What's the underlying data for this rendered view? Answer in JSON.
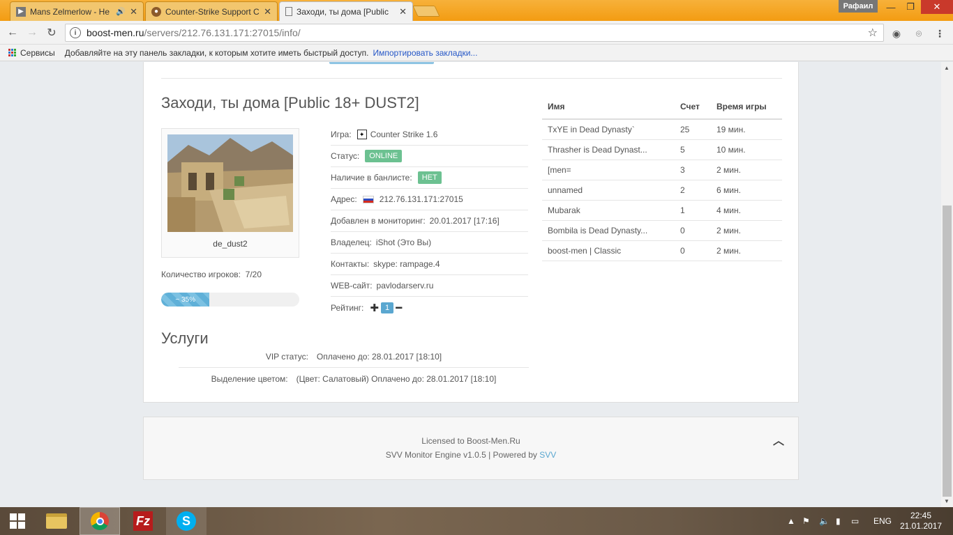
{
  "browser": {
    "tabs": [
      {
        "title": "Mans Zelmerlow - He",
        "icon": "youtube-icon"
      },
      {
        "title": "Counter-Strike Support C",
        "icon": "cs-icon"
      },
      {
        "title": "Заходи, ты дома [Public",
        "icon": "page-icon"
      }
    ],
    "user": "Рафаил",
    "url_host": "boost-men.ru",
    "url_path": "/servers/212.76.131.171:27015/info/",
    "bookmarks": {
      "apps_label": "Сервисы",
      "hint": "Добавляйте на эту панель закладки, к которым хотите иметь быстрый доступ.",
      "import_link": "Импортировать закладки..."
    }
  },
  "server": {
    "title": "Заходи, ты дома [Public 18+ DUST2]",
    "map": "de_dust2",
    "players_label": "Количество игроков:",
    "players_value": "7/20",
    "load_percent": 35,
    "load_label": "~ 35%",
    "info": {
      "game_label": "Игра:",
      "game_value": "Counter Strike 1.6",
      "status_label": "Статус:",
      "status_value": "ONLINE",
      "ban_label": "Наличие в банлисте:",
      "ban_value": "НЕТ",
      "addr_label": "Адрес:",
      "addr_value": "212.76.131.171:27015",
      "added_label": "Добавлен в мониторинг:",
      "added_value": "20.01.2017 [17:16]",
      "owner_label": "Владелец:",
      "owner_value": "iShot (Это Вы)",
      "contacts_label": "Контакты:",
      "contacts_value": "skype: rampage.4",
      "web_label": "WEB-сайт:",
      "web_value": "pavlodarserv.ru",
      "rating_label": "Рейтинг:",
      "rating_value": "1"
    },
    "services_title": "Услуги",
    "services": [
      {
        "name": "VIP статус:",
        "value": "Оплачено до: 28.01.2017 [18:10]"
      },
      {
        "name": "Выделение цветом:",
        "value": "(Цвет: Салатовый) Оплачено до: 28.01.2017 [18:10]"
      }
    ],
    "table": {
      "headers": [
        "Имя",
        "Счет",
        "Время игры"
      ],
      "rows": [
        [
          "TxYE in Dead Dynasty`",
          "25",
          "19 мин."
        ],
        [
          "Thrasher is Dead Dynast...",
          "5",
          "10 мин."
        ],
        [
          "[men=",
          "3",
          "2 мин."
        ],
        [
          "unnamed",
          "2",
          "6 мин."
        ],
        [
          "Mubarak",
          "1",
          "4 мин."
        ],
        [
          "Bombila is Dead Dynasty...",
          "0",
          "2 мин."
        ],
        [
          "boost-men | Classic",
          "0",
          "2 мин."
        ]
      ]
    }
  },
  "footer": {
    "line1": "Licensed to Boost-Men.Ru",
    "line2_prefix": "SVV Monitor Engine v1.0.5 | Powered by",
    "line2_link": "SVV"
  },
  "taskbar": {
    "lang": "ENG",
    "time": "22:45",
    "date": "21.01.2017"
  },
  "colors": {
    "accent": "#5aa7d0",
    "online": "#6cc191",
    "chrome_frame": "#f39c12"
  }
}
